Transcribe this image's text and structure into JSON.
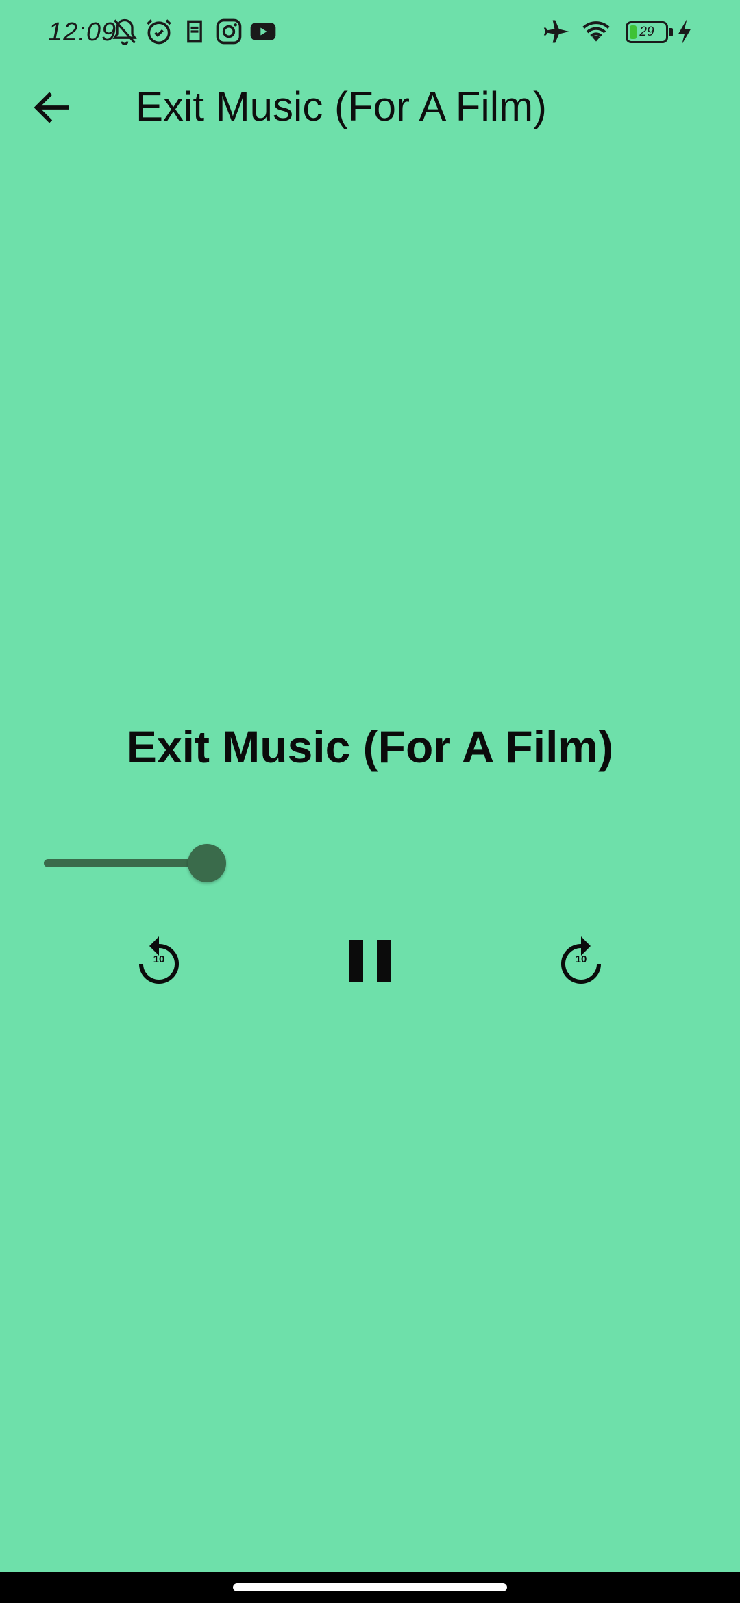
{
  "status_bar": {
    "time": "12:09",
    "battery_level": "29",
    "battery_fraction": 0.29,
    "left_icons": [
      "bell-off-icon",
      "alarm-icon",
      "app-notification-icon",
      "instagram-icon",
      "youtube-icon"
    ],
    "right_icons": [
      "airplane-mode-icon",
      "wifi-icon",
      "battery-icon",
      "charging-icon"
    ]
  },
  "app_bar": {
    "title": "Exit Music (For A Film)",
    "back_icon": "arrow-back-icon"
  },
  "player": {
    "track_title": "Exit Music (For A Film)",
    "progress_fraction": 0.25,
    "replay_label": "10",
    "forward_label": "10",
    "play_state_icon": "pause-icon"
  },
  "colors": {
    "background": "#6ee0aa",
    "slider": "#3a6b4b",
    "text": "#0b0b0b"
  }
}
